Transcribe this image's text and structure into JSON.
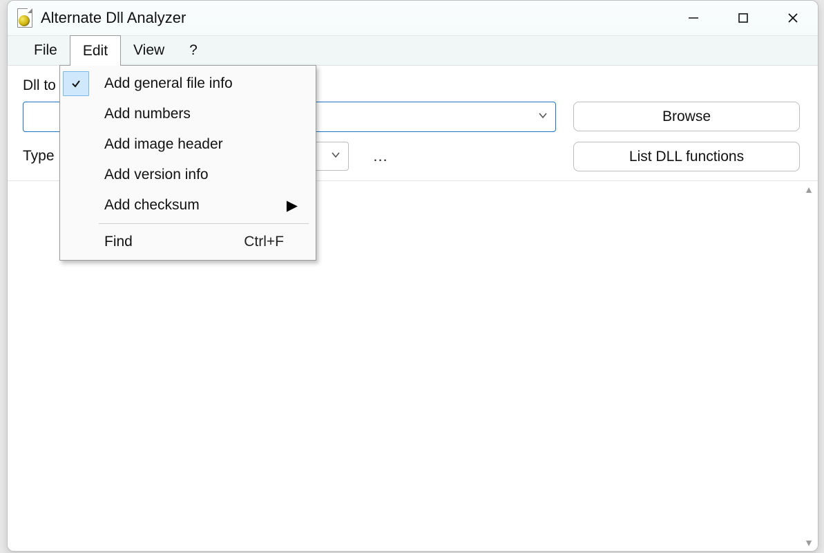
{
  "window": {
    "title": "Alternate Dll Analyzer"
  },
  "menubar": {
    "items": [
      "File",
      "Edit",
      "View",
      "?"
    ],
    "open_index": 1
  },
  "edit_menu": {
    "items": [
      {
        "label": "Add general file info",
        "checked": true,
        "hasSubmenu": false,
        "shortcut": ""
      },
      {
        "label": "Add numbers",
        "checked": false,
        "hasSubmenu": false,
        "shortcut": ""
      },
      {
        "label": "Add image header",
        "checked": false,
        "hasSubmenu": false,
        "shortcut": ""
      },
      {
        "label": "Add version info",
        "checked": false,
        "hasSubmenu": false,
        "shortcut": ""
      },
      {
        "label": "Add checksum",
        "checked": false,
        "hasSubmenu": true,
        "shortcut": ""
      },
      {
        "separator": true
      },
      {
        "label": "Find",
        "checked": false,
        "hasSubmenu": false,
        "shortcut": "Ctrl+F"
      }
    ]
  },
  "form": {
    "dll_label_partial": "Dll to",
    "type_label": "Type",
    "dll_path_value": "",
    "type_value": "",
    "ellipsis": "...",
    "browse_label": "Browse",
    "list_label": "List DLL functions"
  }
}
